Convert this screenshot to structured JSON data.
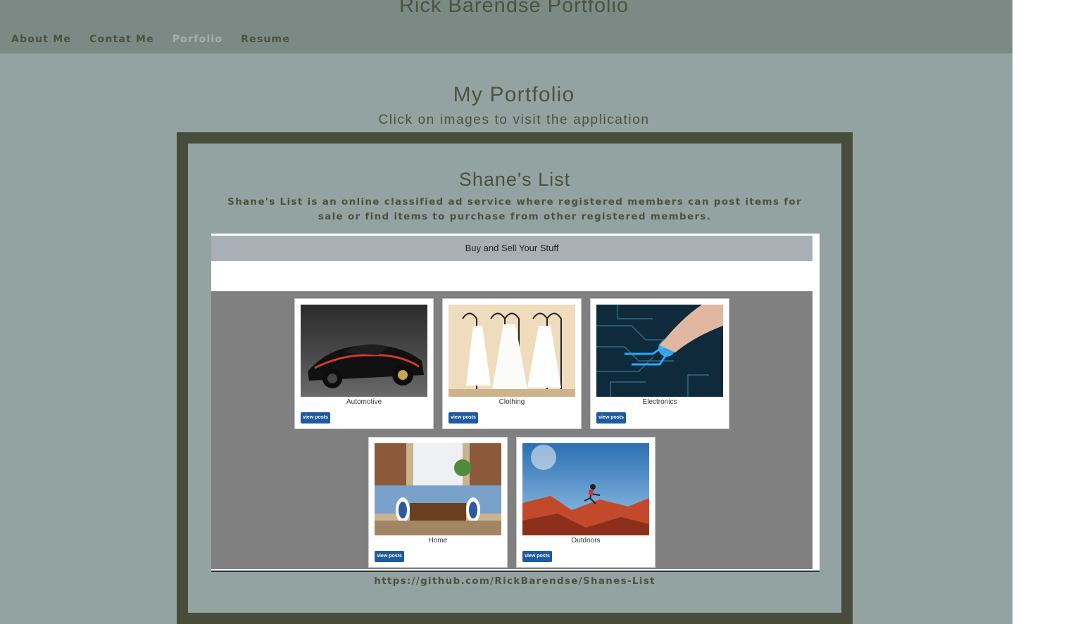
{
  "header": {
    "site_title": "Rick Barendse Portfolio",
    "nav": [
      {
        "label": "About Me"
      },
      {
        "label": "Contat Me"
      },
      {
        "label": "Porfolio",
        "active": true
      },
      {
        "label": "Resume"
      }
    ]
  },
  "main": {
    "heading": "My Portfolio",
    "subheading": "Click on images to visit the application",
    "project": {
      "title": "Shane's List",
      "description": "Shane's List is an online classified ad service where registered members can post items for sale or find items to purchase from other registered members.",
      "screenshot": {
        "app_bar": "Buy and Sell Your Stuff",
        "button_label": "view posts",
        "categories": [
          {
            "label": "Automotive",
            "image": "sports-car-image"
          },
          {
            "label": "Clothing",
            "image": "wedding-dresses-image"
          },
          {
            "label": "Electronics",
            "image": "circuit-board-image"
          },
          {
            "label": "Home",
            "image": "living-room-image"
          },
          {
            "label": "Outdoors",
            "image": "hiker-jumping-image"
          }
        ]
      },
      "repo_url": "https://github.com/RickBarendse/Shanes-List"
    }
  },
  "colors": {
    "page_bg": "#93a3a2",
    "header_bg": "#7b8a84",
    "frame": "#474d3a",
    "text": "#4b5240",
    "active_nav": "#a2b1b1",
    "button": "#1f5aa0"
  }
}
